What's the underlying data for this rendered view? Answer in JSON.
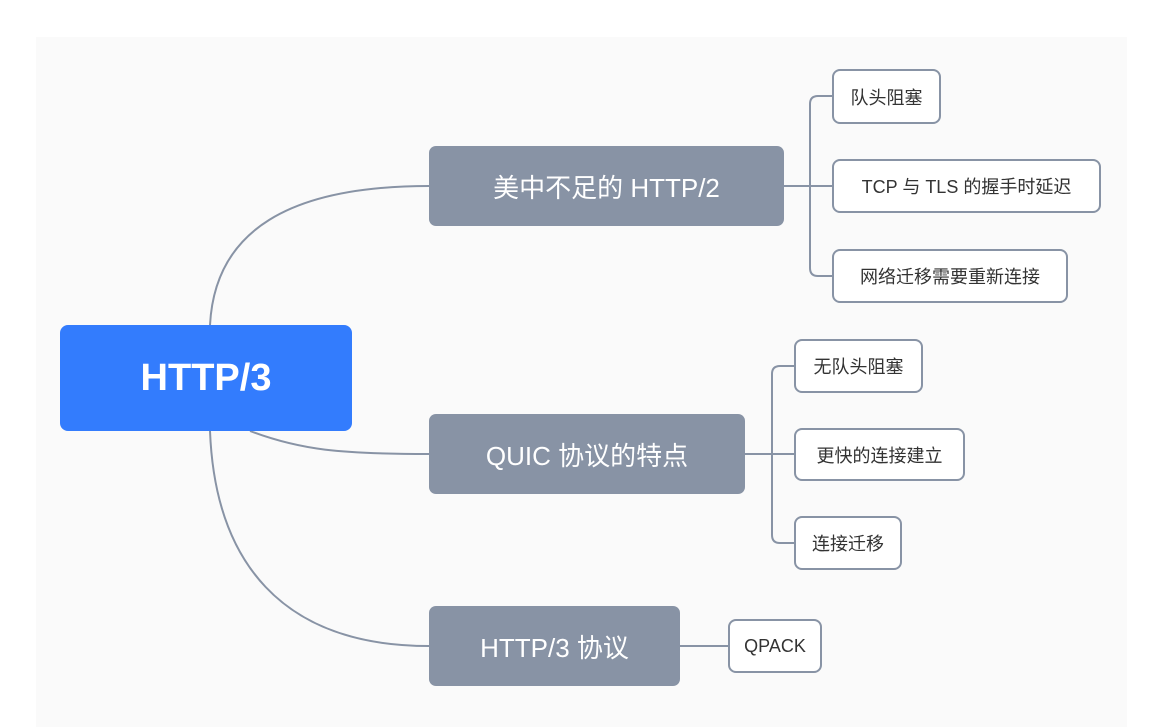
{
  "root": {
    "label": "HTTP/3"
  },
  "branches": [
    {
      "label": "美中不足的 HTTP/2",
      "children": [
        "队头阻塞",
        "TCP 与 TLS 的握手时延迟",
        "网络迁移需要重新连接"
      ]
    },
    {
      "label": "QUIC 协议的特点",
      "children": [
        "无队头阻塞",
        "更快的连接建立",
        "连接迁移"
      ]
    },
    {
      "label": "HTTP/3 协议",
      "children": [
        "QPACK"
      ]
    }
  ],
  "colors": {
    "root": "#337cfd",
    "branch": "#8893a5",
    "line": "#8893a5",
    "background": "#fafafa"
  }
}
